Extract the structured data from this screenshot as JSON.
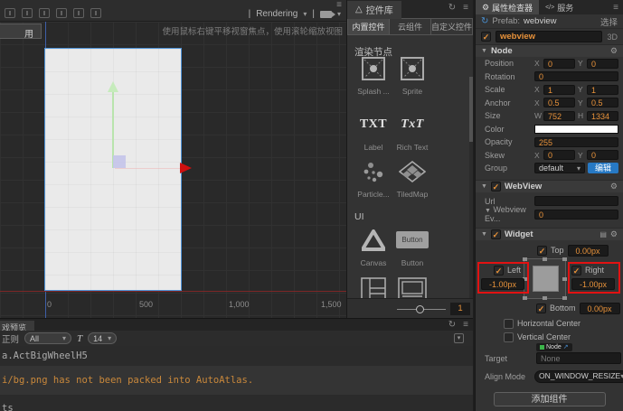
{
  "icons": {
    "check": "✓",
    "menu": "≡",
    "refresh": "↻",
    "gear": "⚙",
    "caret": "▾",
    "section_arrow": "▼",
    "triangle": "△",
    "services": "</>",
    "link": "↗",
    "sync": "↻",
    "pipe": "|",
    "t_glyph": "T"
  },
  "scene": {
    "rendering_label": "Rendering",
    "hint": "使用鼠标右键平移视窗焦点，使用滚轮缩放视图",
    "partial_button": "用",
    "ruler_ticks": [
      "0",
      "500",
      "1,000",
      "1,500"
    ]
  },
  "widget_library": {
    "title": "控件库",
    "tabs": [
      "内置控件",
      "云组件",
      "自定义控件"
    ],
    "section_render": "渲染节点",
    "section_ui": "UI",
    "items": [
      {
        "label": "Splash ..."
      },
      {
        "label": "Sprite"
      },
      {
        "label": "Label",
        "icon_text": "TXT"
      },
      {
        "label": "Rich Text",
        "icon_text": "TxT"
      },
      {
        "label": "Particle..."
      },
      {
        "label": "TiledMap"
      },
      {
        "label": "Canvas"
      },
      {
        "label": "Button",
        "icon_text": "Button"
      }
    ],
    "zoom_value": "1"
  },
  "console": {
    "tab": "戏预览",
    "regex_label": "正则",
    "filter_value": "All",
    "font_size": "14",
    "logs": [
      {
        "text": "a.ActBigWheelH5"
      },
      {
        "text": "i/bg.png has not been packed into AutoAtlas."
      },
      {
        "text": "ts"
      }
    ]
  },
  "inspector": {
    "tab_properties": "属性检查器",
    "tab_services": "服务",
    "prefab_label": "Prefab:",
    "prefab_value": "webview",
    "select_label": "选择",
    "node_name": "webview",
    "dim_label": "3D",
    "axis": {
      "x": "X",
      "y": "Y",
      "w": "W",
      "h": "H"
    },
    "node_section": {
      "title": "Node",
      "position": {
        "label": "Position",
        "x": "0",
        "y": "0"
      },
      "rotation": {
        "label": "Rotation",
        "value": "0"
      },
      "scale": {
        "label": "Scale",
        "x": "1",
        "y": "1"
      },
      "anchor": {
        "label": "Anchor",
        "x": "0.5",
        "y": "0.5"
      },
      "size": {
        "label": "Size",
        "w": "752",
        "h": "1334"
      },
      "color": {
        "label": "Color",
        "value": "#FFFFFF"
      },
      "opacity": {
        "label": "Opacity",
        "value": "255"
      },
      "skew": {
        "label": "Skew",
        "x": "0",
        "y": "0"
      },
      "group": {
        "label": "Group",
        "value": "default",
        "edit_label": "编辑"
      }
    },
    "webview_section": {
      "title": "WebView",
      "url_label": "Url",
      "url_value": "",
      "events_label": "Webview Ev...",
      "events_value": "0"
    },
    "widget_section": {
      "title": "Widget",
      "top": {
        "label": "Top",
        "value": "0.00px"
      },
      "left": {
        "label": "Left",
        "value": "-1.00px"
      },
      "right": {
        "label": "Right",
        "value": "-1.00px"
      },
      "bottom": {
        "label": "Bottom",
        "value": "0.00px"
      },
      "h_center_label": "Horizontal Center",
      "v_center_label": "Vertical Center",
      "target_label": "Target",
      "target_value": "None",
      "target_type": "Node",
      "align_label": "Align Mode",
      "align_value": "ON_WINDOW_RESIZE"
    },
    "add_component_label": "添加组件",
    "accent_orange": "#e8923a",
    "accent_blue": "#2779c4",
    "annotation_red": "#e21212"
  }
}
